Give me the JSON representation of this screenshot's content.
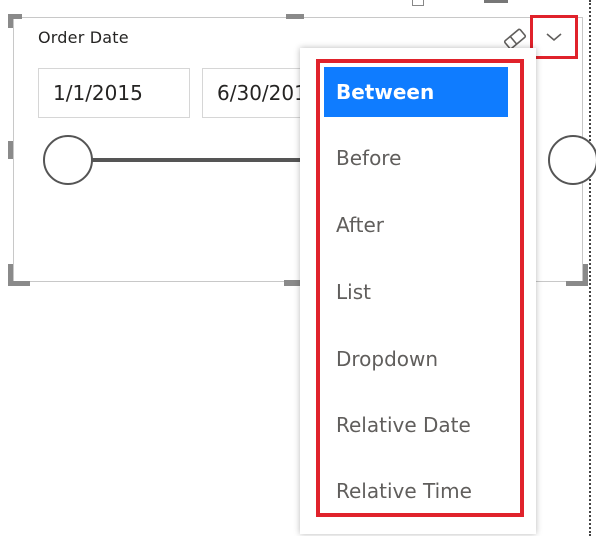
{
  "slicer": {
    "header": "Order Date",
    "start_date": "1/1/2015",
    "end_date": "6/30/2016",
    "icons": {
      "clear": "eraser-icon",
      "toggle": "chevron-down-icon"
    }
  },
  "menu": {
    "items": [
      {
        "label": "Between",
        "selected": true
      },
      {
        "label": "Before",
        "selected": false
      },
      {
        "label": "After",
        "selected": false
      },
      {
        "label": "List",
        "selected": false
      },
      {
        "label": "Dropdown",
        "selected": false
      },
      {
        "label": "Relative Date",
        "selected": false
      },
      {
        "label": "Relative Time",
        "selected": false
      }
    ]
  },
  "colors": {
    "selected_bg": "#0f7cff",
    "highlight_border": "#e0222b",
    "text": "#252423",
    "muted_text": "#605e5c"
  }
}
